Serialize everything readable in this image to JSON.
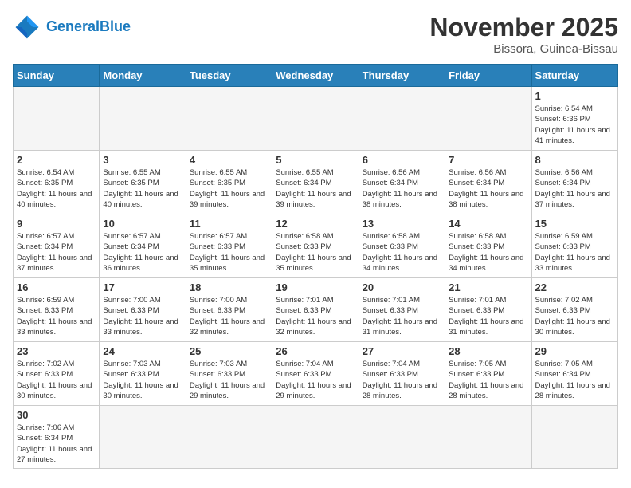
{
  "header": {
    "logo_general": "General",
    "logo_blue": "Blue",
    "month_year": "November 2025",
    "location": "Bissora, Guinea-Bissau"
  },
  "weekdays": [
    "Sunday",
    "Monday",
    "Tuesday",
    "Wednesday",
    "Thursday",
    "Friday",
    "Saturday"
  ],
  "weeks": [
    [
      {
        "day": "",
        "info": ""
      },
      {
        "day": "",
        "info": ""
      },
      {
        "day": "",
        "info": ""
      },
      {
        "day": "",
        "info": ""
      },
      {
        "day": "",
        "info": ""
      },
      {
        "day": "",
        "info": ""
      },
      {
        "day": "1",
        "info": "Sunrise: 6:54 AM\nSunset: 6:36 PM\nDaylight: 11 hours\nand 41 minutes."
      }
    ],
    [
      {
        "day": "2",
        "info": "Sunrise: 6:54 AM\nSunset: 6:35 PM\nDaylight: 11 hours\nand 40 minutes."
      },
      {
        "day": "3",
        "info": "Sunrise: 6:55 AM\nSunset: 6:35 PM\nDaylight: 11 hours\nand 40 minutes."
      },
      {
        "day": "4",
        "info": "Sunrise: 6:55 AM\nSunset: 6:35 PM\nDaylight: 11 hours\nand 39 minutes."
      },
      {
        "day": "5",
        "info": "Sunrise: 6:55 AM\nSunset: 6:34 PM\nDaylight: 11 hours\nand 39 minutes."
      },
      {
        "day": "6",
        "info": "Sunrise: 6:56 AM\nSunset: 6:34 PM\nDaylight: 11 hours\nand 38 minutes."
      },
      {
        "day": "7",
        "info": "Sunrise: 6:56 AM\nSunset: 6:34 PM\nDaylight: 11 hours\nand 38 minutes."
      },
      {
        "day": "8",
        "info": "Sunrise: 6:56 AM\nSunset: 6:34 PM\nDaylight: 11 hours\nand 37 minutes."
      }
    ],
    [
      {
        "day": "9",
        "info": "Sunrise: 6:57 AM\nSunset: 6:34 PM\nDaylight: 11 hours\nand 37 minutes."
      },
      {
        "day": "10",
        "info": "Sunrise: 6:57 AM\nSunset: 6:34 PM\nDaylight: 11 hours\nand 36 minutes."
      },
      {
        "day": "11",
        "info": "Sunrise: 6:57 AM\nSunset: 6:33 PM\nDaylight: 11 hours\nand 35 minutes."
      },
      {
        "day": "12",
        "info": "Sunrise: 6:58 AM\nSunset: 6:33 PM\nDaylight: 11 hours\nand 35 minutes."
      },
      {
        "day": "13",
        "info": "Sunrise: 6:58 AM\nSunset: 6:33 PM\nDaylight: 11 hours\nand 34 minutes."
      },
      {
        "day": "14",
        "info": "Sunrise: 6:58 AM\nSunset: 6:33 PM\nDaylight: 11 hours\nand 34 minutes."
      },
      {
        "day": "15",
        "info": "Sunrise: 6:59 AM\nSunset: 6:33 PM\nDaylight: 11 hours\nand 33 minutes."
      }
    ],
    [
      {
        "day": "16",
        "info": "Sunrise: 6:59 AM\nSunset: 6:33 PM\nDaylight: 11 hours\nand 33 minutes."
      },
      {
        "day": "17",
        "info": "Sunrise: 7:00 AM\nSunset: 6:33 PM\nDaylight: 11 hours\nand 33 minutes."
      },
      {
        "day": "18",
        "info": "Sunrise: 7:00 AM\nSunset: 6:33 PM\nDaylight: 11 hours\nand 32 minutes."
      },
      {
        "day": "19",
        "info": "Sunrise: 7:01 AM\nSunset: 6:33 PM\nDaylight: 11 hours\nand 32 minutes."
      },
      {
        "day": "20",
        "info": "Sunrise: 7:01 AM\nSunset: 6:33 PM\nDaylight: 11 hours\nand 31 minutes."
      },
      {
        "day": "21",
        "info": "Sunrise: 7:01 AM\nSunset: 6:33 PM\nDaylight: 11 hours\nand 31 minutes."
      },
      {
        "day": "22",
        "info": "Sunrise: 7:02 AM\nSunset: 6:33 PM\nDaylight: 11 hours\nand 30 minutes."
      }
    ],
    [
      {
        "day": "23",
        "info": "Sunrise: 7:02 AM\nSunset: 6:33 PM\nDaylight: 11 hours\nand 30 minutes."
      },
      {
        "day": "24",
        "info": "Sunrise: 7:03 AM\nSunset: 6:33 PM\nDaylight: 11 hours\nand 30 minutes."
      },
      {
        "day": "25",
        "info": "Sunrise: 7:03 AM\nSunset: 6:33 PM\nDaylight: 11 hours\nand 29 minutes."
      },
      {
        "day": "26",
        "info": "Sunrise: 7:04 AM\nSunset: 6:33 PM\nDaylight: 11 hours\nand 29 minutes."
      },
      {
        "day": "27",
        "info": "Sunrise: 7:04 AM\nSunset: 6:33 PM\nDaylight: 11 hours\nand 28 minutes."
      },
      {
        "day": "28",
        "info": "Sunrise: 7:05 AM\nSunset: 6:33 PM\nDaylight: 11 hours\nand 28 minutes."
      },
      {
        "day": "29",
        "info": "Sunrise: 7:05 AM\nSunset: 6:34 PM\nDaylight: 11 hours\nand 28 minutes."
      }
    ],
    [
      {
        "day": "30",
        "info": "Sunrise: 7:06 AM\nSunset: 6:34 PM\nDaylight: 11 hours\nand 27 minutes."
      },
      {
        "day": "",
        "info": ""
      },
      {
        "day": "",
        "info": ""
      },
      {
        "day": "",
        "info": ""
      },
      {
        "day": "",
        "info": ""
      },
      {
        "day": "",
        "info": ""
      },
      {
        "day": "",
        "info": ""
      }
    ]
  ]
}
